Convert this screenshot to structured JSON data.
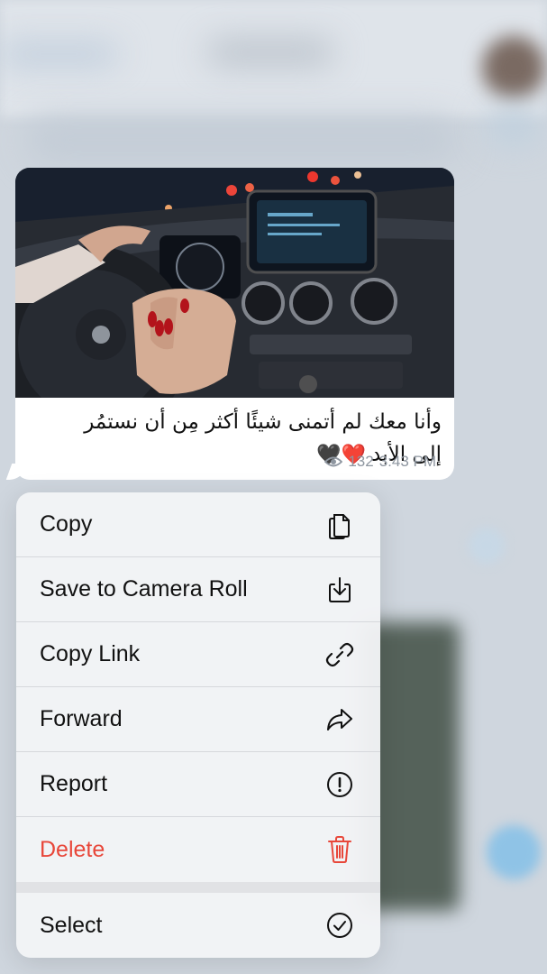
{
  "message": {
    "caption_line1": "وأنا معك لم أتمنى شيئًا أكثر مِن أن نستمُر",
    "caption_line2": "إلى الأبد",
    "hearts": "❤️🖤",
    "views": "132",
    "time": "3:43 PM"
  },
  "context_menu": {
    "items": [
      {
        "label": "Copy",
        "icon": "copy-icon"
      },
      {
        "label": "Save to Camera Roll",
        "icon": "download-icon"
      },
      {
        "label": "Copy Link",
        "icon": "link-icon"
      },
      {
        "label": "Forward",
        "icon": "forward-arrow-icon"
      },
      {
        "label": "Report",
        "icon": "exclamation-circle-icon"
      },
      {
        "label": "Delete",
        "icon": "trash-icon"
      },
      {
        "label": "Select",
        "icon": "checkmark-circle-icon"
      }
    ]
  },
  "colors": {
    "danger": "#e8473a",
    "menu_bg": "#f3f4f6",
    "bubble_bg": "#ffffff",
    "meta_text": "#8e96a0"
  }
}
